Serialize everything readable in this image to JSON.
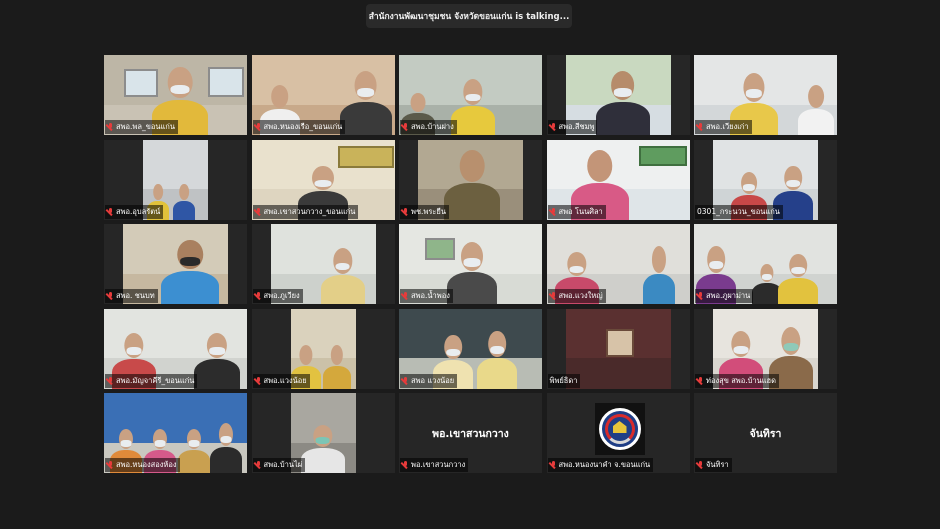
{
  "banner": {
    "talking_text": "สำนักงานพัฒนาชุมชน จังหวัดขอนแก่น is talking..."
  },
  "icons": {
    "mic_muted": "mic-muted-icon"
  },
  "colors": {
    "background": "#1b1b1b",
    "tile_background": "#262626",
    "mute_icon": "#e63b3b"
  },
  "participants": [
    {
      "name": "สพอ.พล_ขอนแก่น",
      "video": true
    },
    {
      "name": "สพอ.หนองเรือ_ขอนแก่น",
      "video": true
    },
    {
      "name": "สพอ.บ้านฝาง",
      "video": true
    },
    {
      "name": "สพอ.สีชมพู",
      "video": true
    },
    {
      "name": "สพอ.เวียงเก่า",
      "video": true
    },
    {
      "name": "สพอ.อุบลรัตน์",
      "video": true
    },
    {
      "name": "สพอ.เขาสวนกวาง_ขอนแก่น",
      "video": true
    },
    {
      "name": "พช.พระยืน",
      "video": true
    },
    {
      "name": "สพอ โนนศิลา",
      "video": true
    },
    {
      "name": "0301_กระนวน_ขอนแก่น",
      "video": true
    },
    {
      "name": "สพอ. ชนบท",
      "video": true
    },
    {
      "name": "สพอ.ภูเวียง",
      "video": true
    },
    {
      "name": "สพอ.น้ำพอง",
      "video": true
    },
    {
      "name": "สพอ.แวงใหญ่",
      "video": true
    },
    {
      "name": "สพอ.ภูผาม่าน",
      "video": true
    },
    {
      "name": "สพอ.มัญจาคีรี_ขอนแก่น",
      "video": true
    },
    {
      "name": "สพอ.แวงน้อย",
      "video": true
    },
    {
      "name": "สพอ แวงน้อย",
      "video": true
    },
    {
      "name": "พิพย์ธิดา",
      "video": true
    },
    {
      "name": "ท่องสุข สพอ.บ้านแฮด",
      "video": true
    },
    {
      "name": "สพอ.หนองสองห้อง",
      "video": true
    },
    {
      "name": "สพอ.บ้านไผ่",
      "video": true
    },
    {
      "name": "พอ.เขาสวนกวาง",
      "video": false,
      "display_name": "พอ.เขาสวนกวาง"
    },
    {
      "name": "สพอ.หนองนาคำ จ.ขอนแก่น",
      "video": false,
      "logo": true
    },
    {
      "name": "จันทิรา",
      "video": false,
      "display_name": "จันทิรา"
    }
  ]
}
